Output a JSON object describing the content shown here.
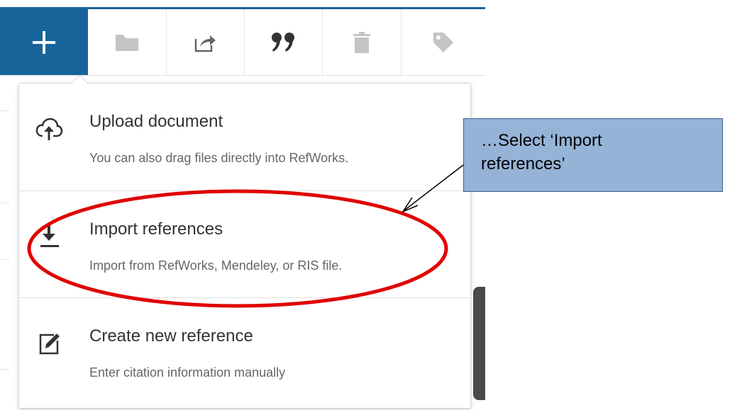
{
  "toolbar": {
    "buttons": [
      {
        "name": "add",
        "icon": "plus-icon"
      },
      {
        "name": "folder",
        "icon": "folder-icon"
      },
      {
        "name": "share",
        "icon": "share-icon"
      },
      {
        "name": "cite",
        "icon": "quote-icon"
      },
      {
        "name": "delete",
        "icon": "trash-icon"
      },
      {
        "name": "tag",
        "icon": "tag-icon"
      }
    ],
    "accent": "#17649a"
  },
  "menu": {
    "items": [
      {
        "icon": "cloud-upload-icon",
        "title": "Upload document",
        "desc": "You can also drag files directly into RefWorks."
      },
      {
        "icon": "import-icon",
        "title": "Import references",
        "desc": "Import from RefWorks, Mendeley, or RIS file."
      },
      {
        "icon": "edit-icon",
        "title": "Create new reference",
        "desc": "Enter citation information manually"
      }
    ]
  },
  "annotation": {
    "callout_line1": "…Select ‘Import",
    "callout_line2": "references’",
    "highlight_color": "#e00000",
    "callout_color": "#95b3d7"
  }
}
